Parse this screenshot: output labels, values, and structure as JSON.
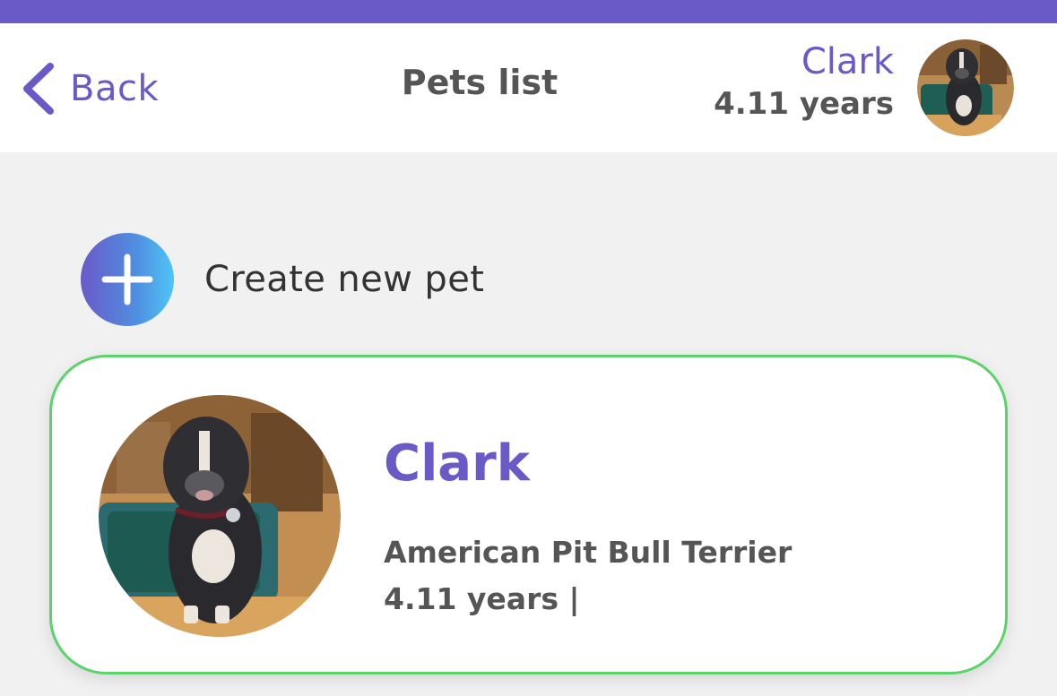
{
  "header": {
    "back_label": "Back",
    "title": "Pets list",
    "pet_name": "Clark",
    "pet_age": "4.11 years"
  },
  "create": {
    "label": "Create new pet"
  },
  "pets": [
    {
      "name": "Clark",
      "breed": "American Pit Bull Terrier",
      "age_line": "4.11 years |"
    }
  ],
  "colors": {
    "accent": "#6a5ac8",
    "card_border": "#5cd36a",
    "text_dark": "#555555",
    "gradient_end": "#4ec6f6"
  },
  "icons": {
    "back": "chevron-left-icon",
    "add": "plus-icon"
  }
}
